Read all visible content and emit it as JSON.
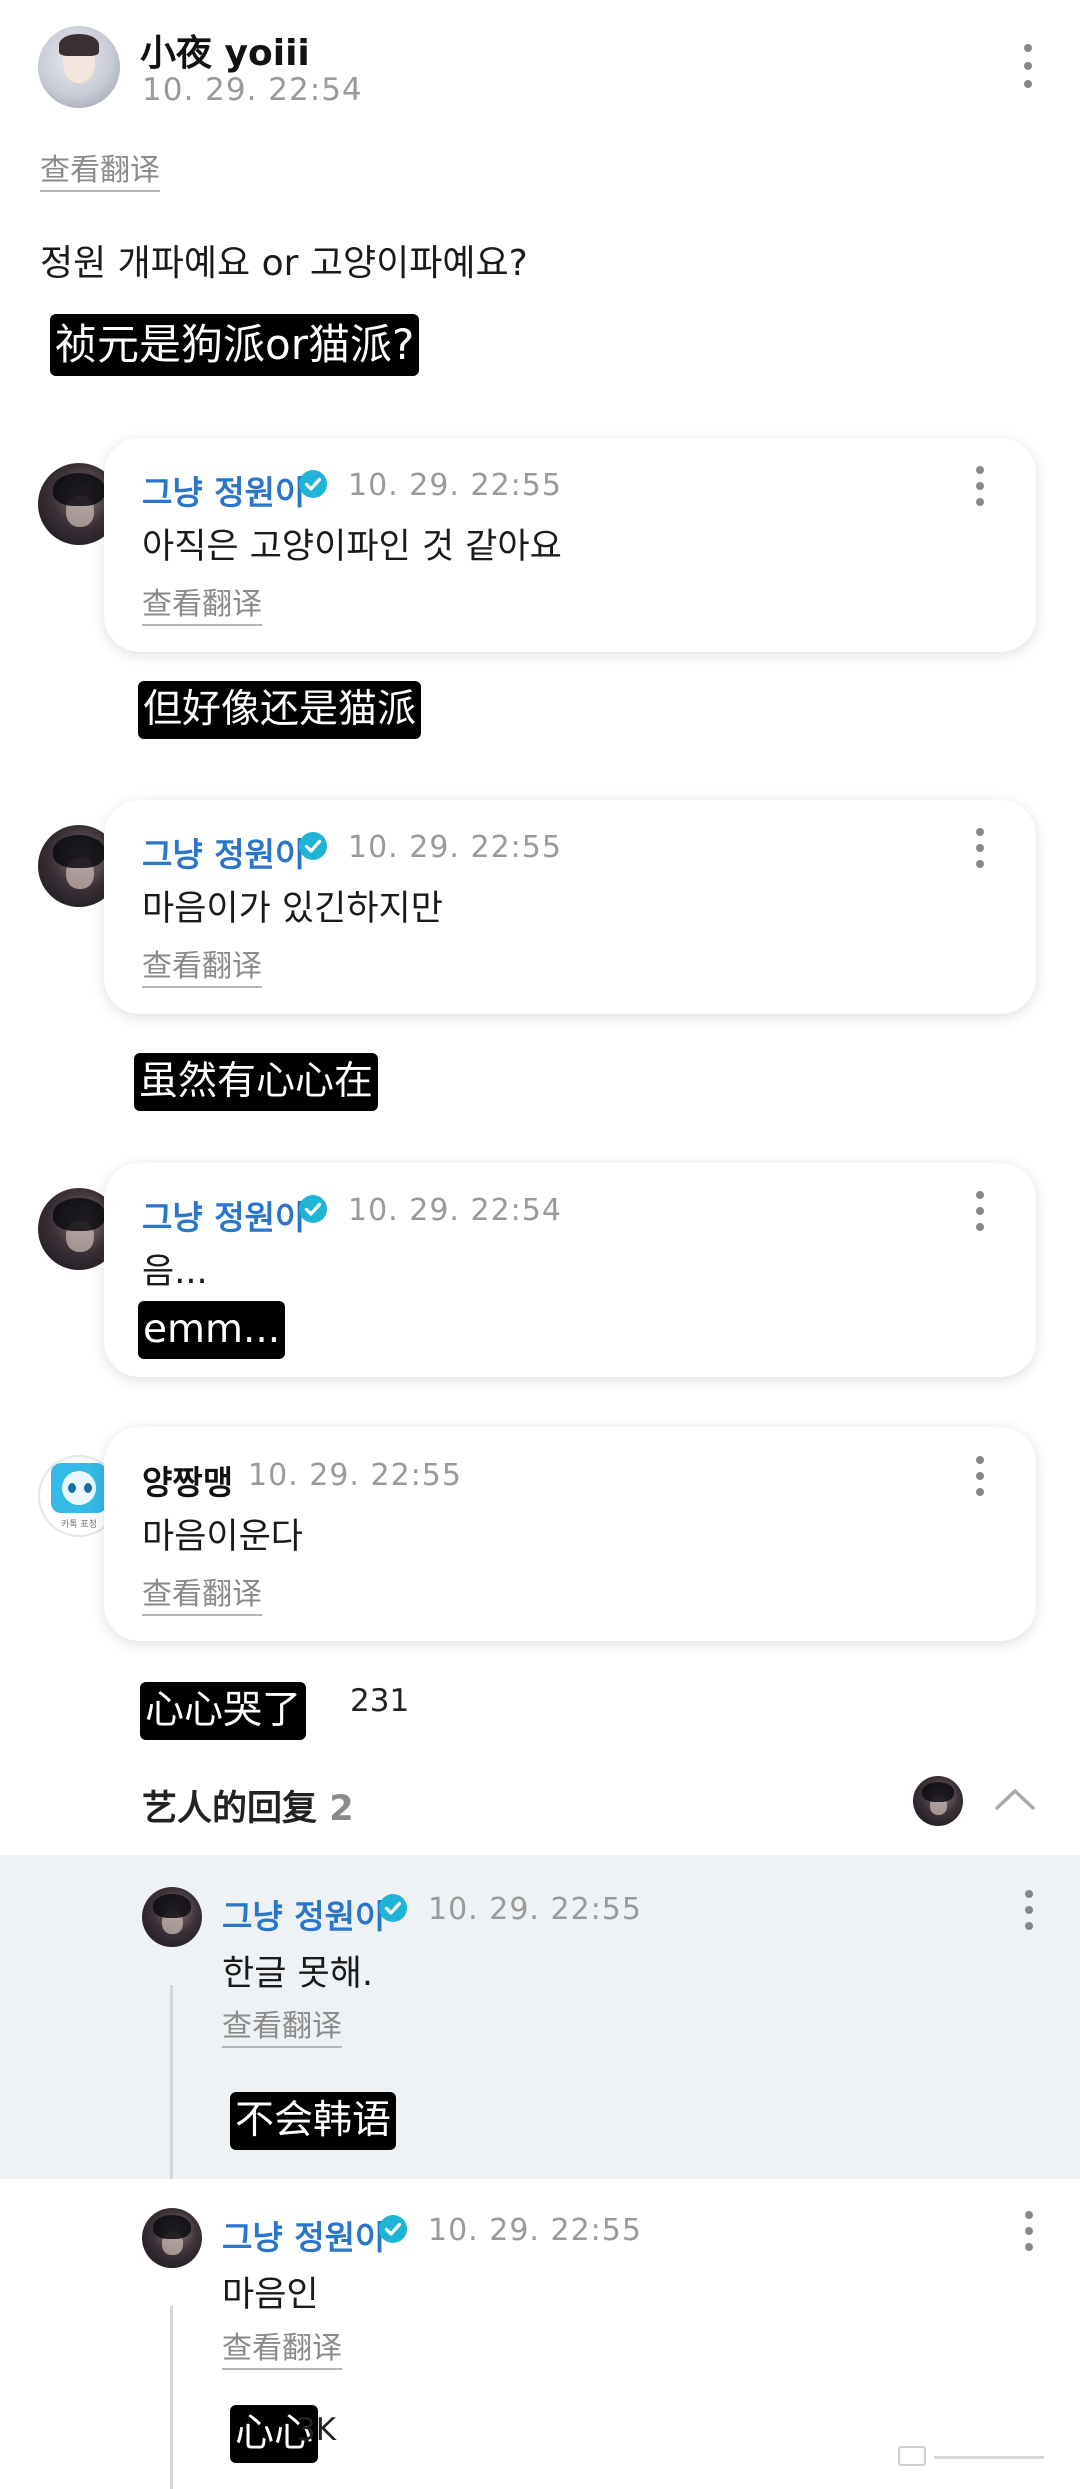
{
  "post": {
    "author": "小夜 yoiii",
    "time": "10. 29. 22:54",
    "translate": "查看翻译",
    "text": "정원 개파예요 or 고양이파예요?",
    "caption": "祯元是狗派or猫派?"
  },
  "comments": [
    {
      "author": "그냥 정원이",
      "time": "10. 29. 22:55",
      "text": "아직은 고양이파인 것 같아요",
      "translate": "查看翻译",
      "caption": "但好像还是猫派"
    },
    {
      "author": "그냥 정원이",
      "time": "10. 29. 22:55",
      "text": "마음이가 있긴하지만",
      "translate": "查看翻译",
      "caption": "虽然有心心在"
    },
    {
      "author": "그냥 정원이",
      "time": "10. 29. 22:54",
      "text": "음...",
      "caption": "emm..."
    },
    {
      "author": "양짱맹",
      "time": "10. 29. 22:55",
      "text": "마음이운다",
      "translate": "查看翻译",
      "caption": "心心哭了",
      "like_count": "231",
      "avatar_caption": "카톡 표정"
    }
  ],
  "artist_replies": {
    "label": "艺人的回复",
    "count": "2",
    "items": [
      {
        "author": "그냥 정원이",
        "time": "10. 29. 22:55",
        "text": "한글 못해.",
        "translate": "查看翻译",
        "caption": "不会韩语"
      },
      {
        "author": "그냥 정원이",
        "time": "10. 29. 22:55",
        "text": "마음인",
        "translate": "查看翻译",
        "caption": "心心",
        "tail": "3K"
      }
    ]
  },
  "colors": {
    "accent_blue": "#2a76c8",
    "verified": "#1fb3d6",
    "caption_bg": "#000000",
    "reply_bg": "#eef2f4"
  }
}
